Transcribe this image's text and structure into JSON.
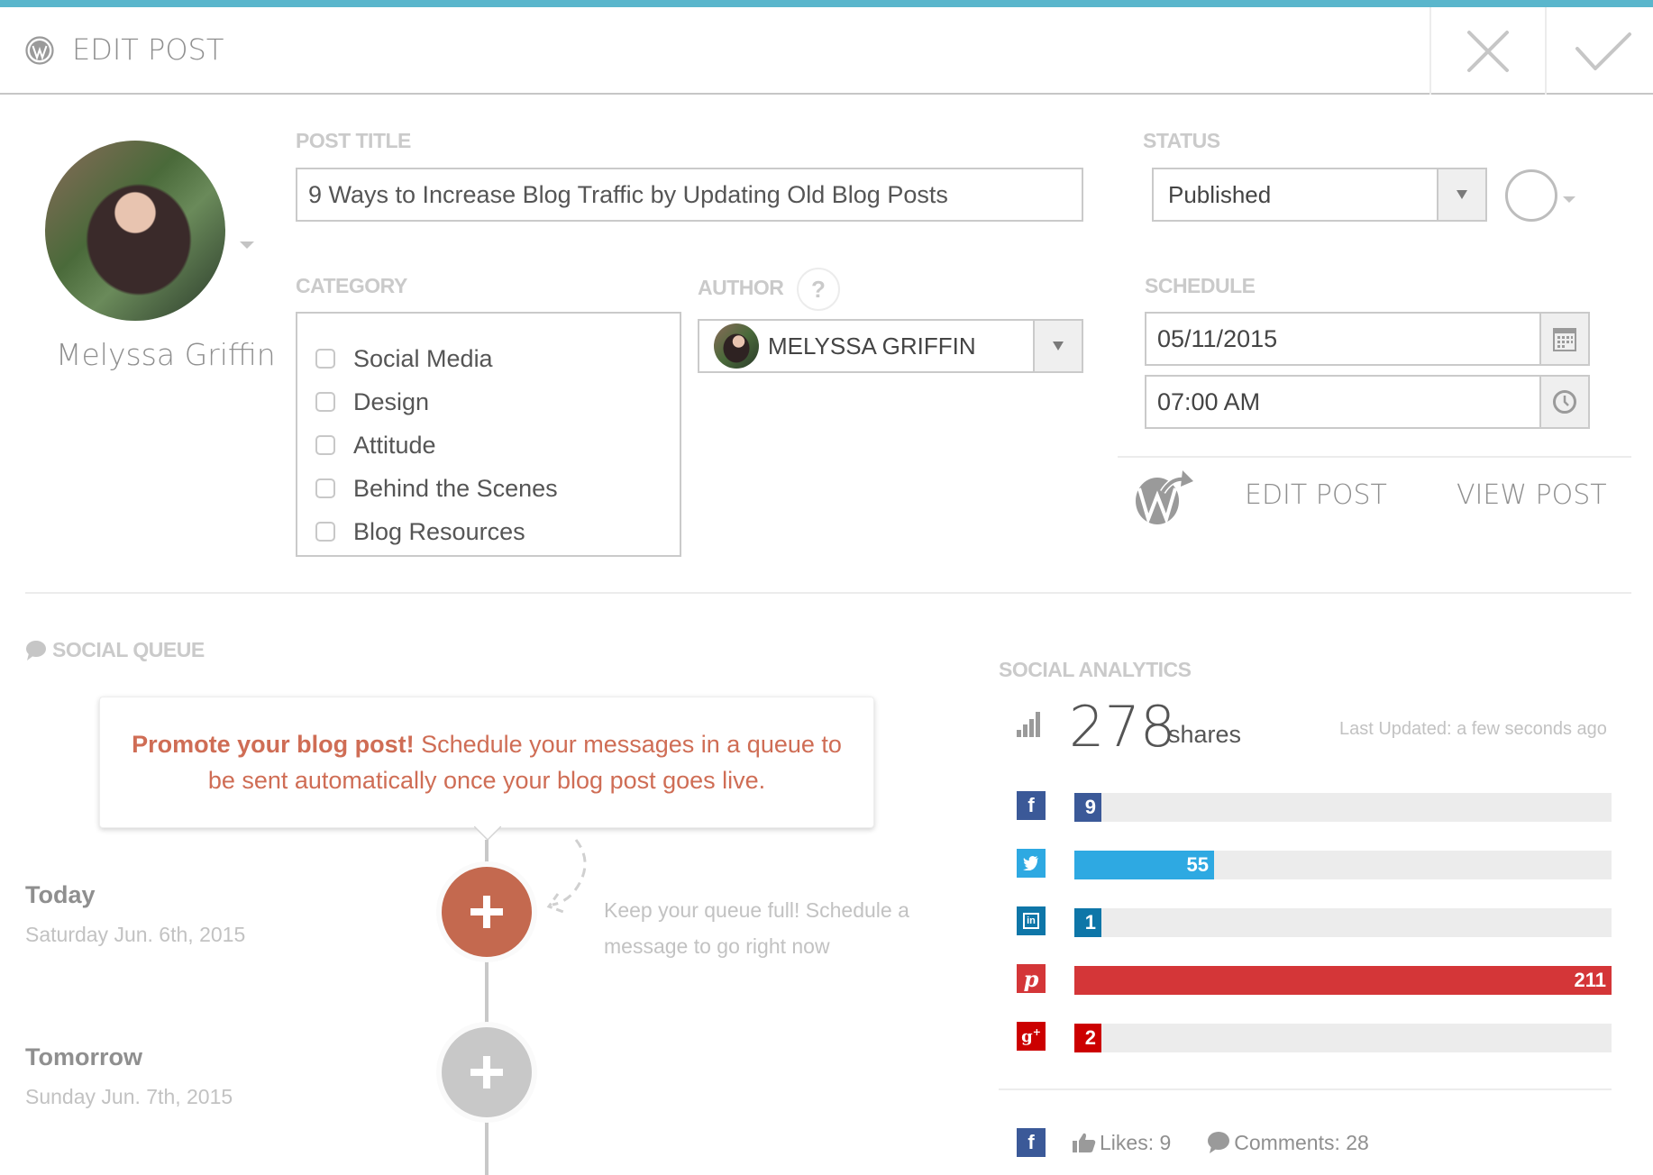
{
  "header": {
    "title": "EDIT POST",
    "icons": {
      "logo": "wordpress-icon",
      "close": "close-icon",
      "confirm": "check-icon"
    },
    "accent_color": "#5ab6cc"
  },
  "profile": {
    "name": "Melyssa Griffin"
  },
  "post_title": {
    "label": "POST TITLE",
    "value": "9 Ways to Increase Blog Traffic by Updating Old Blog Posts"
  },
  "status": {
    "label": "STATUS",
    "selected": "Published"
  },
  "category": {
    "label": "CATEGORY",
    "items": [
      {
        "label": "Social Media",
        "checked": false
      },
      {
        "label": "Design",
        "checked": false
      },
      {
        "label": "Attitude",
        "checked": false
      },
      {
        "label": "Behind the Scenes",
        "checked": false
      },
      {
        "label": "Blog Resources",
        "checked": false
      }
    ]
  },
  "author": {
    "label": "AUTHOR",
    "help": "?",
    "selected": "MELYSSA GRIFFIN"
  },
  "schedule": {
    "label": "SCHEDULE",
    "date": "05/11/2015",
    "time": "07:00 AM"
  },
  "post_links": {
    "edit": "EDIT POST",
    "view": "VIEW POST"
  },
  "social_queue": {
    "title": "SOCIAL QUEUE",
    "promo_bold": "Promote your blog post!",
    "promo_rest": " Schedule your messages in a queue to be sent automatically once your blog post goes live.",
    "accent_color": "#c4694f",
    "days": [
      {
        "title": "Today",
        "date": "Saturday Jun. 6th, 2015",
        "active": true
      },
      {
        "title": "Tomorrow",
        "date": "Sunday Jun. 7th, 2015",
        "active": false
      }
    ],
    "hint": "Keep your queue full! Schedule a message to go right now"
  },
  "social_analytics": {
    "title": "SOCIAL ANALYTICS",
    "total": "278",
    "total_unit": "shares",
    "last_updated": "Last Updated: a few seconds ago",
    "networks": [
      {
        "name": "facebook",
        "icon": "f",
        "count": 9,
        "color": "#3b5998"
      },
      {
        "name": "twitter",
        "icon": "t",
        "count": 55,
        "color": "#2ea9e2"
      },
      {
        "name": "linkedin",
        "icon": "in",
        "count": 1,
        "color": "#0e76a8"
      },
      {
        "name": "pinterest",
        "icon": "p",
        "count": 211,
        "color": "#d43638"
      },
      {
        "name": "google-plus",
        "icon": "g+",
        "count": 2,
        "color": "#cc0000"
      }
    ],
    "facebook_stats": {
      "likes": "Likes: 9",
      "comments": "Comments: 28"
    }
  }
}
